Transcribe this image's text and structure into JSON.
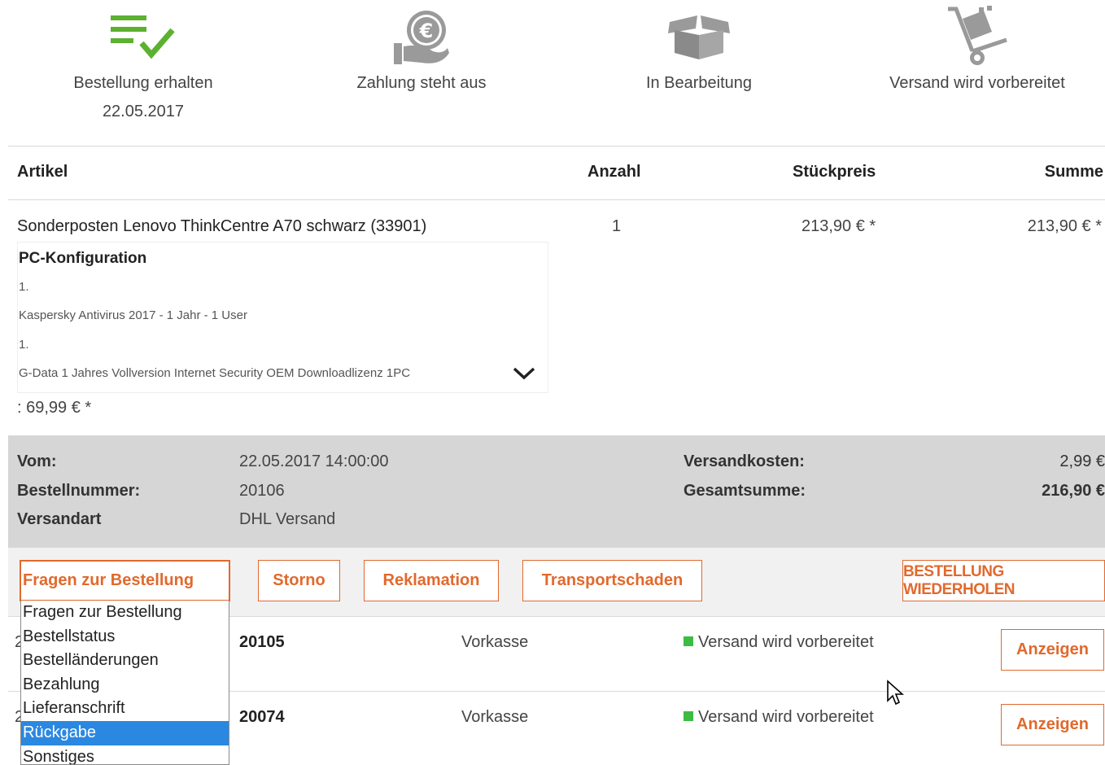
{
  "status_steps": [
    {
      "icon": "checklist-icon",
      "label": "Bestellung erhalten",
      "date": "22.05.2017",
      "color": "#5cb130"
    },
    {
      "icon": "euro-payment-icon",
      "label": "Zahlung steht aus",
      "color": "#9a9a9a"
    },
    {
      "icon": "open-box-icon",
      "label": "In Bearbeitung",
      "color": "#9a9a9a"
    },
    {
      "icon": "hand-truck-icon",
      "label": "Versand wird vorbereitet",
      "color": "#9a9a9a"
    }
  ],
  "table": {
    "headers": {
      "artikel": "Artikel",
      "anzahl": "Anzahl",
      "stueckpreis": "Stückpreis",
      "summe": "Summe"
    },
    "item": {
      "name": "Sonderposten Lenovo ThinkCentre A70 schwarz (33901)",
      "quantity": "1",
      "unit_price": "213,90 € *",
      "total": "213,90 € *"
    },
    "configuration": {
      "title": "PC-Konfiguration",
      "lines": [
        "1.",
        "Kaspersky Antivirus 2017 - 1 Jahr - 1 User",
        "1.",
        "G-Data 1 Jahres Vollversion Internet Security OEM Downloadlizenz 1PC"
      ]
    },
    "extra_price": ": 69,99 € *"
  },
  "summary": {
    "date_label": "Vom:",
    "date_value": "22.05.2017 14:00:00",
    "order_label": "Bestellnummer:",
    "order_value": "20106",
    "shipping_method_label": "Versandart",
    "shipping_method_value": "DHL Versand",
    "shipping_cost_label": "Versandkosten:",
    "shipping_cost_value": "2,99 €",
    "total_label": "Gesamtsumme:",
    "total_value": "216,90 €"
  },
  "actions": {
    "select_value": "Fragen zur Bestellung",
    "storno": "Storno",
    "reklamation": "Reklamation",
    "transportschaden": "Transportschaden",
    "repeat": "BESTELLUNG WIEDERHOLEN",
    "accent_color": "#e1692d"
  },
  "dropdown": {
    "options": [
      "Fragen zur Bestellung",
      "Bestellstatus",
      "Bestelländerungen",
      "Bezahlung",
      "Lieferanschrift",
      "Rückgabe",
      "Sonstiges"
    ],
    "selected": "Rückgabe"
  },
  "orders": [
    {
      "number": "20105",
      "payment": "Vorkasse",
      "status": "Versand wird vorbereitet",
      "button": "Anzeigen"
    },
    {
      "number": "20074",
      "payment": "Vorkasse",
      "status": "Versand wird vorbereitet",
      "button": "Anzeigen"
    }
  ]
}
